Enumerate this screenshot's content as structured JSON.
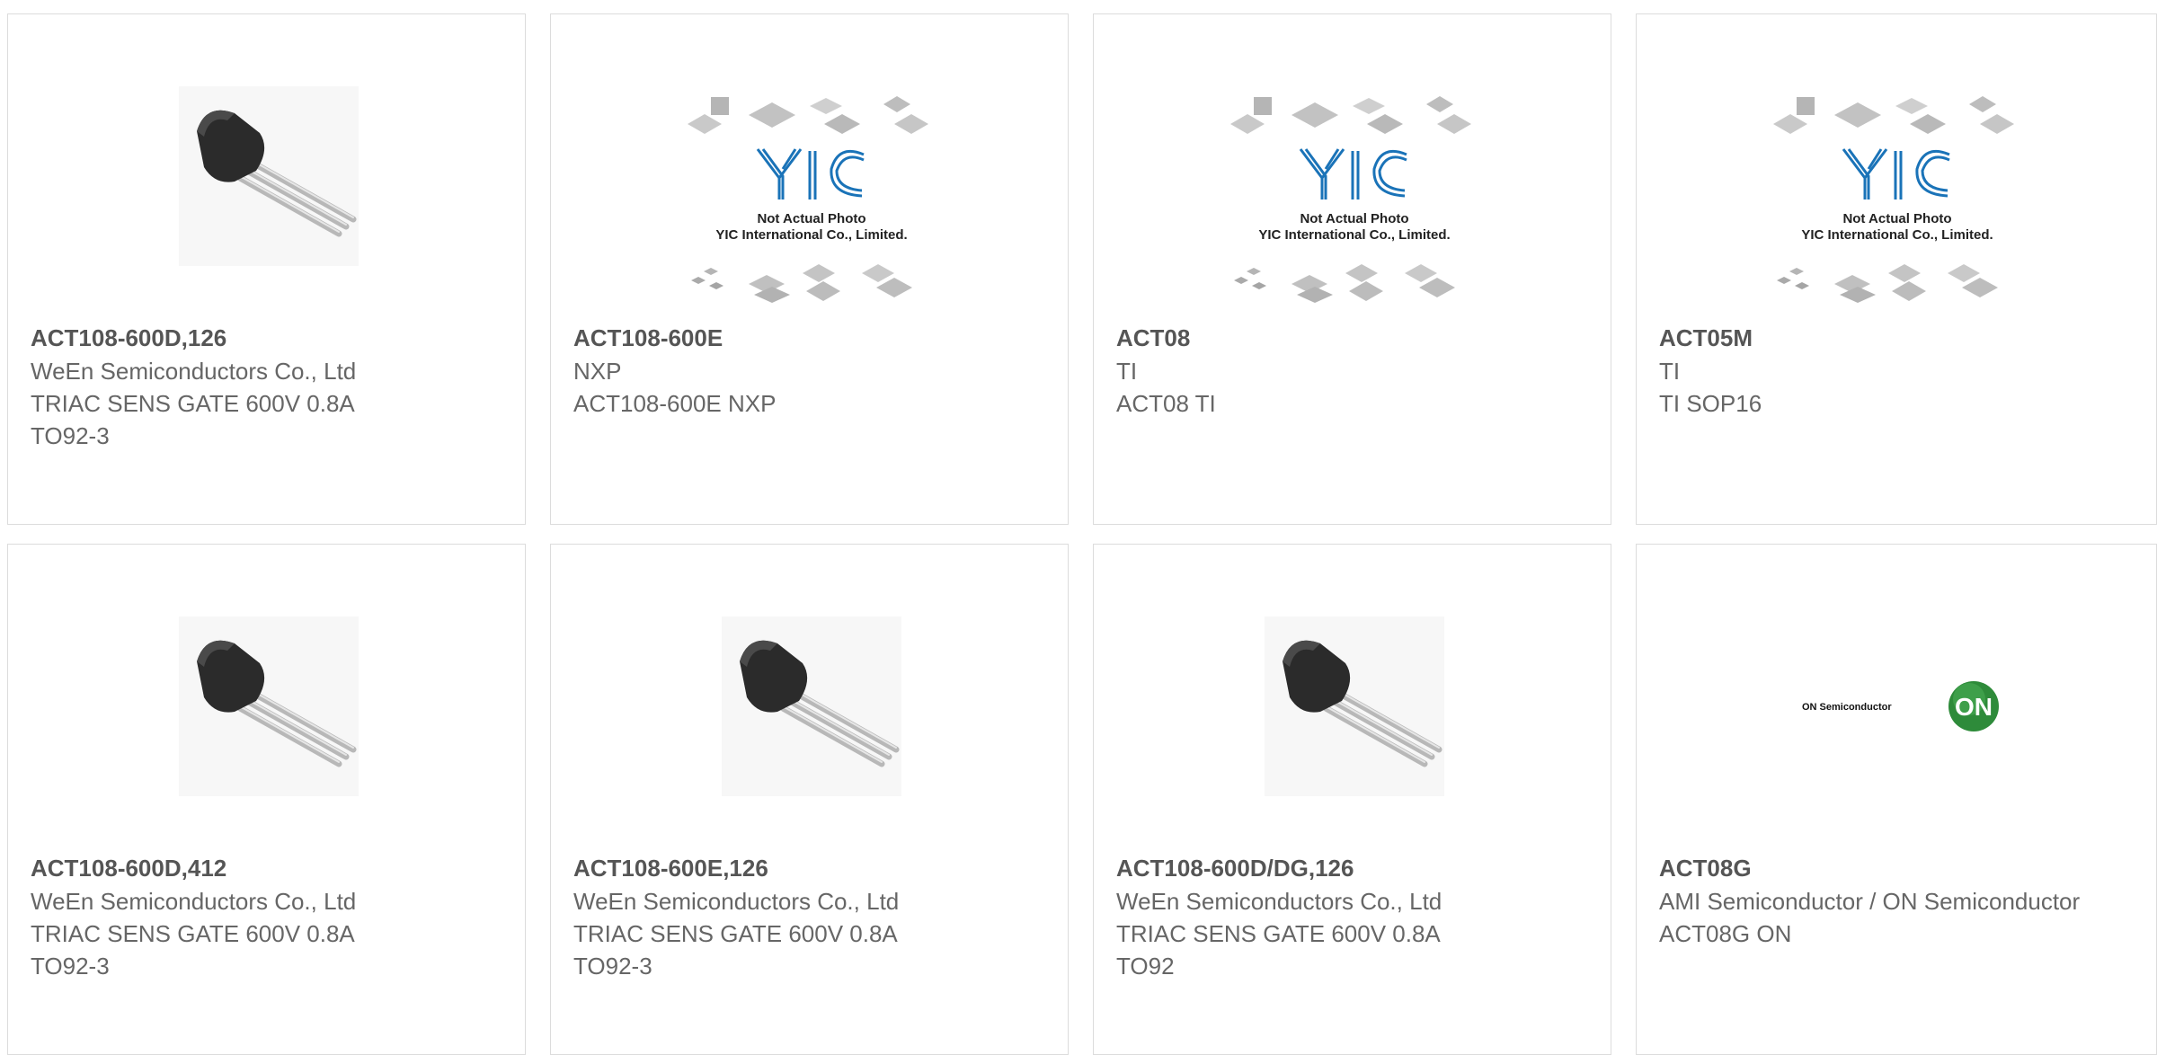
{
  "colors": {
    "accent": "#e8431b",
    "bar": "#3f3f3f",
    "card_border": "#dcdcdc",
    "title": "#555555",
    "text": "#666666",
    "yic_blue": "#1a73b8",
    "on_green": "#2e8b3a"
  },
  "placeholder_image": {
    "line1": "Not Actual Photo",
    "line2": "YIC International Co., Limited.",
    "logo": "YIC"
  },
  "on_logo": {
    "wordmark": "ON Semiconductor",
    "badge": "ON"
  },
  "products": [
    {
      "image": "to92-transistor",
      "part_number": "ACT108-600D,126",
      "manufacturer": "WeEn Semiconductors Co., Ltd",
      "description_line1": "TRIAC SENS GATE 600V 0.8A",
      "description_line2": "TO92-3"
    },
    {
      "image": "yic-placeholder",
      "part_number": "ACT108-600E",
      "manufacturer": "NXP",
      "description_line1": "ACT108-600E NXP",
      "description_line2": ""
    },
    {
      "image": "yic-placeholder",
      "part_number": "ACT08",
      "manufacturer": "TI",
      "description_line1": "ACT08 TI",
      "description_line2": ""
    },
    {
      "image": "yic-placeholder",
      "part_number": "ACT05M",
      "manufacturer": "TI",
      "description_line1": "TI SOP16",
      "description_line2": ""
    },
    {
      "image": "to92-transistor",
      "part_number": "ACT108-600D,412",
      "manufacturer": "WeEn Semiconductors Co., Ltd",
      "description_line1": "TRIAC SENS GATE 600V 0.8A",
      "description_line2": "TO92-3"
    },
    {
      "image": "to92-transistor",
      "part_number": "ACT108-600E,126",
      "manufacturer": "WeEn Semiconductors Co., Ltd",
      "description_line1": "TRIAC SENS GATE 600V 0.8A",
      "description_line2": "TO92-3"
    },
    {
      "image": "to92-transistor",
      "part_number": "ACT108-600D/DG,126",
      "manufacturer": "WeEn Semiconductors Co., Ltd",
      "description_line1": "TRIAC SENS GATE 600V 0.8A",
      "description_line2": "TO92"
    },
    {
      "image": "on-semiconductor-logo",
      "part_number": "ACT08G",
      "manufacturer": "AMI Semiconductor / ON Semiconductor",
      "description_line1": "ACT08G ON",
      "description_line2": ""
    }
  ]
}
